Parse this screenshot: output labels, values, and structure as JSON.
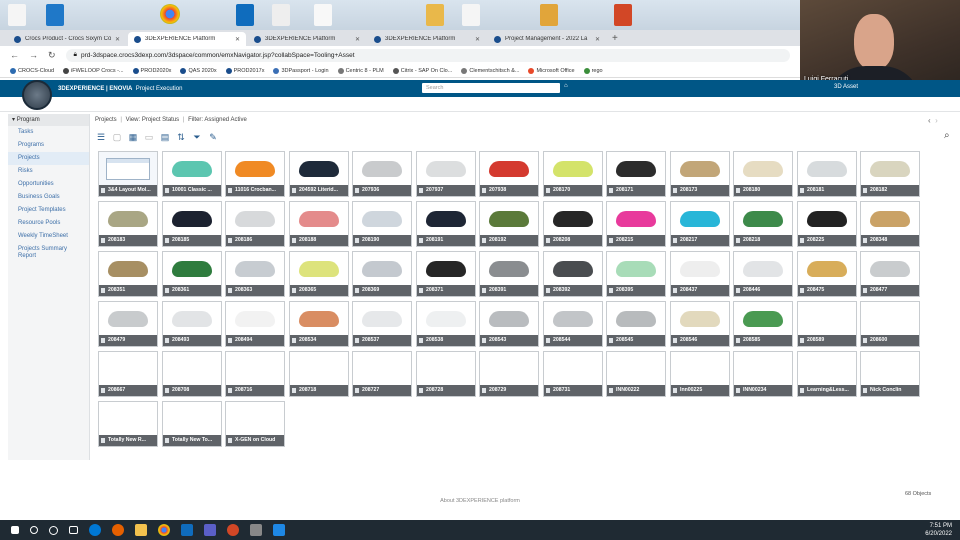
{
  "browser": {
    "tabs": [
      {
        "label": "Crocs Product - Crocs Sixym Co"
      },
      {
        "label": "3DEXPERIENCE Platform",
        "active": true
      },
      {
        "label": "3DEXPERIENCE Platform"
      },
      {
        "label": "3DEXPERIENCE Platform"
      },
      {
        "label": "Project Management - 2022 La"
      }
    ],
    "new_tab": "+",
    "url": "prd-3dspace.crocs3dexp.com/3dspace/common/emxNavigator.jsp?collabSpace=Tooling+Asset",
    "bookmarks": [
      "CROCS-Cloud",
      "iFWELOOP Crocs -...",
      "PROD2020x",
      "QAS 2020x",
      "PROD2017x",
      "3DPassport - Login",
      "Centric 8 - PLM",
      "Citrix - SAP On Clo...",
      "Clementschitsch &...",
      "Microsoft Office",
      "rego"
    ]
  },
  "webcam": {
    "name": "Luigi Ferracuti"
  },
  "app": {
    "brand_bold": "3DEXPERIENCE | ENOVIA",
    "brand_app": "Project Execution",
    "search_placeholder": "Search",
    "role": "3D Asset"
  },
  "leftnav": {
    "header": "Program",
    "items": [
      "Tasks",
      "Programs",
      "Projects",
      "Risks",
      "Opportunities",
      "Business Goals",
      "Project Templates",
      "Resource Pools",
      "Weekly TimeSheet",
      "Projects Summary Report"
    ]
  },
  "breadcrumb": {
    "root": "Projects",
    "view": "View: Project Status",
    "filter": "Filter: Assigned Active"
  },
  "tiles": [
    {
      "label": "3&4 Layout Mol...",
      "img": "doc"
    },
    {
      "label": "10001 Classic ...",
      "img": "#5cc6b0"
    },
    {
      "label": "11016 Crocban...",
      "img": "#f08a24"
    },
    {
      "label": "204592 Literid...",
      "img": "#1e2a3a"
    },
    {
      "label": "207936",
      "img": "#c9cbcd"
    },
    {
      "label": "207937",
      "img": "#dcdedf"
    },
    {
      "label": "207938",
      "img": "#d43a2f"
    },
    {
      "label": "208170",
      "img": "#d4e36a"
    },
    {
      "label": "208171",
      "img": "#2c2c2c"
    },
    {
      "label": "208173",
      "img": "#c2a678"
    },
    {
      "label": "208180",
      "img": "#e6dcc2"
    },
    {
      "label": "208181",
      "img": "#d7dbdd"
    },
    {
      "label": "208182",
      "img": "#d9d5bf"
    },
    {
      "label": "208183",
      "img": "#a9a684"
    },
    {
      "label": "208185",
      "img": "#1c2230"
    },
    {
      "label": "208186",
      "img": "#d7d9db"
    },
    {
      "label": "208188",
      "img": "#e48b8b"
    },
    {
      "label": "208190",
      "img": "#cfd6dd"
    },
    {
      "label": "208191",
      "img": "#1e2635"
    },
    {
      "label": "208192",
      "img": "#5b7a3a"
    },
    {
      "label": "208208",
      "img": "#262626"
    },
    {
      "label": "208215",
      "img": "#e83a9c"
    },
    {
      "label": "208217",
      "img": "#28b6d8"
    },
    {
      "label": "208218",
      "img": "#3d8a4a"
    },
    {
      "label": "208225",
      "img": "#222222"
    },
    {
      "label": "208348",
      "img": "#caa266"
    },
    {
      "label": "208351",
      "img": "#a78f63"
    },
    {
      "label": "208361",
      "img": "#2f7c3e"
    },
    {
      "label": "208363",
      "img": "#c7ccd1"
    },
    {
      "label": "208365",
      "img": "#dde37c"
    },
    {
      "label": "208369",
      "img": "#c4c9cf"
    },
    {
      "label": "208371",
      "img": "#262626"
    },
    {
      "label": "208391",
      "img": "#8a8d90"
    },
    {
      "label": "208392",
      "img": "#4a4d50"
    },
    {
      "label": "208395",
      "img": "#a8dcb8"
    },
    {
      "label": "208437",
      "img": "#eeeeee"
    },
    {
      "label": "208446",
      "img": "#e2e4e6"
    },
    {
      "label": "208475",
      "img": "#d8ad5a"
    },
    {
      "label": "208477",
      "img": "#c9ccce"
    },
    {
      "label": "208479",
      "img": "#c8cbcd"
    },
    {
      "label": "208493",
      "img": "#e2e4e6"
    },
    {
      "label": "208494",
      "img": "#f2f2f2"
    },
    {
      "label": "208534",
      "img": "#d98d62"
    },
    {
      "label": "208537",
      "img": "#e6e8ea"
    },
    {
      "label": "208538",
      "img": "#eef0f1"
    },
    {
      "label": "208543",
      "img": "#b9bcbf"
    },
    {
      "label": "208544",
      "img": "#c2c5c8"
    },
    {
      "label": "208545",
      "img": "#b8bbbd"
    },
    {
      "label": "208546",
      "img": "#e2d9bd"
    },
    {
      "label": "208585",
      "img": "#4a9a52"
    },
    {
      "label": "208589",
      "img": ""
    },
    {
      "label": "208600",
      "img": ""
    },
    {
      "label": "208667",
      "img": ""
    },
    {
      "label": "208708",
      "img": ""
    },
    {
      "label": "208716",
      "img": ""
    },
    {
      "label": "208718",
      "img": ""
    },
    {
      "label": "208727",
      "img": ""
    },
    {
      "label": "208728",
      "img": ""
    },
    {
      "label": "208729",
      "img": ""
    },
    {
      "label": "208731",
      "img": ""
    },
    {
      "label": "INN00222",
      "img": ""
    },
    {
      "label": "Inn00225",
      "img": ""
    },
    {
      "label": "INN00234",
      "img": ""
    },
    {
      "label": "Learning&Less...",
      "img": ""
    },
    {
      "label": "Nick Conclin",
      "img": ""
    },
    {
      "label": "Totally New R...",
      "img": ""
    },
    {
      "label": "Totally New To...",
      "img": ""
    },
    {
      "label": "X-GEN on Cloud",
      "img": ""
    }
  ],
  "footer": "About 3DEXPERIENCE platform",
  "object_count": "68 Objects",
  "taskbar": {
    "time": "7:51 PM",
    "date": "6/20/2022"
  }
}
